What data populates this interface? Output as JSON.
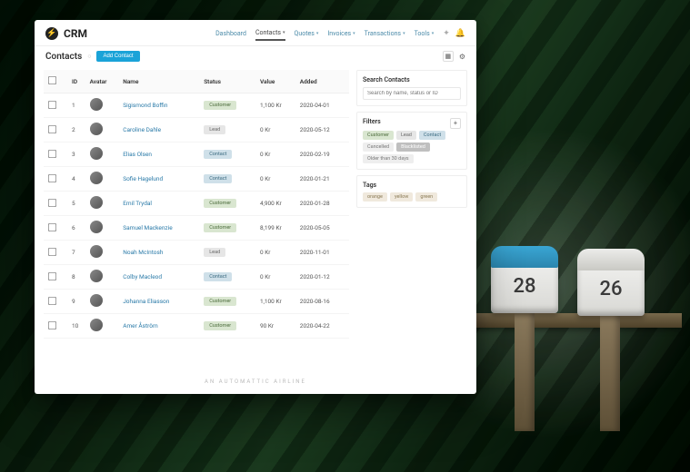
{
  "brand": "CRM",
  "nav": {
    "items": [
      {
        "label": "Dashboard",
        "dropdown": false,
        "active": false
      },
      {
        "label": "Contacts",
        "dropdown": true,
        "active": true
      },
      {
        "label": "Quotes",
        "dropdown": true,
        "active": false
      },
      {
        "label": "Invoices",
        "dropdown": true,
        "active": false
      },
      {
        "label": "Transactions",
        "dropdown": true,
        "active": false
      },
      {
        "label": "Tools",
        "dropdown": true,
        "active": false
      }
    ]
  },
  "page": {
    "title": "Contacts",
    "add_button": "Add Contact"
  },
  "table": {
    "columns": [
      "ID",
      "Avatar",
      "Name",
      "Status",
      "Value",
      "Added"
    ],
    "rows": [
      {
        "id": "1",
        "name": "Sigismond Boffin",
        "status": "Customer",
        "value": "1,100 Kr",
        "added": "2020-04-01"
      },
      {
        "id": "2",
        "name": "Caroline Dahle",
        "status": "Lead",
        "value": "0 Kr",
        "added": "2020-05-12"
      },
      {
        "id": "3",
        "name": "Elias Olsen",
        "status": "Contact",
        "value": "0 Kr",
        "added": "2020-02-19"
      },
      {
        "id": "4",
        "name": "Sofie Hagelund",
        "status": "Contact",
        "value": "0 Kr",
        "added": "2020-01-21"
      },
      {
        "id": "5",
        "name": "Emil Trydal",
        "status": "Customer",
        "value": "4,900 Kr",
        "added": "2020-01-28"
      },
      {
        "id": "6",
        "name": "Samuel Mackenzie",
        "status": "Customer",
        "value": "8,199 Kr",
        "added": "2020-05-05"
      },
      {
        "id": "7",
        "name": "Noah McIntosh",
        "status": "Lead",
        "value": "0 Kr",
        "added": "2020-11-01"
      },
      {
        "id": "8",
        "name": "Colby Macleod",
        "status": "Contact",
        "value": "0 Kr",
        "added": "2020-01-12"
      },
      {
        "id": "9",
        "name": "Johanna Eliasson",
        "status": "Customer",
        "value": "1,100 Kr",
        "added": "2020-08-16"
      },
      {
        "id": "10",
        "name": "Amer Åström",
        "status": "Customer",
        "value": "90 Kr",
        "added": "2020-04-22"
      }
    ]
  },
  "sidebar": {
    "search_title": "Search Contacts",
    "search_placeholder": "Search by name, status or ID",
    "filters_title": "Filters",
    "filters": [
      {
        "label": "Customer",
        "kind": "customer"
      },
      {
        "label": "Lead",
        "kind": "lead"
      },
      {
        "label": "Contact",
        "kind": "contact"
      },
      {
        "label": "Cancelled",
        "kind": "cancelled"
      },
      {
        "label": "Blacklisted",
        "kind": "blacklisted"
      },
      {
        "label": "Older than 30 days",
        "kind": "older"
      }
    ],
    "tags_title": "Tags",
    "tags": [
      "orange",
      "yellow",
      "green"
    ]
  },
  "footer": "AN AUTOMATTIC AIRLINE",
  "mailboxes": {
    "left": "28",
    "right": "26"
  }
}
